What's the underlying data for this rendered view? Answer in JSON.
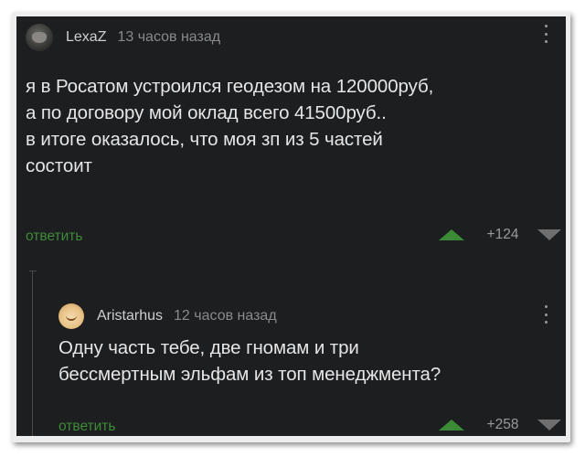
{
  "comments": [
    {
      "username": "LexaZ",
      "timestamp": "13 часов назад",
      "text": "я в Росатом устроился геодезом на 120000руб,\nа по договору мой оклад всего 41500руб..\nв итоге оказалось, что моя зп из 5 частей\nсостоит",
      "reply_label": "ответить",
      "score": "+124",
      "avatar_icon": "cat-avatar-icon"
    },
    {
      "username": "Aristarhus",
      "timestamp": "12 часов назад",
      "text": "Одну часть тебе, две гномам и три\nбессмертным эльфам из топ менеджмента?",
      "reply_label": "ответить",
      "score": "+258",
      "avatar_icon": "smiley-avatar-icon"
    }
  ],
  "colors": {
    "background": "#1d1e20",
    "reply_link": "#3d8b37",
    "upvote": "#3c8a36",
    "downvote": "#6e6e6e",
    "text": "#e6e6e6",
    "muted": "#8a8a8a"
  }
}
